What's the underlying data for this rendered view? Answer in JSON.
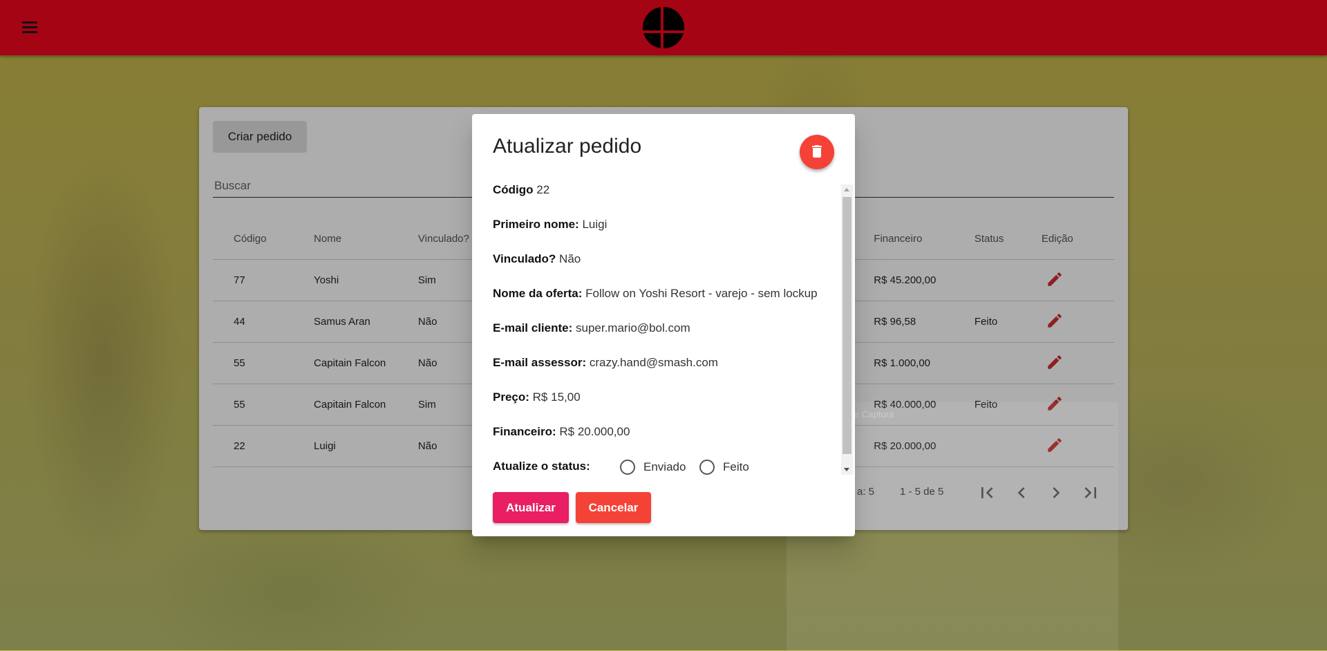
{
  "colors": {
    "topbar": "#a50415",
    "primary_button": "#e91e63",
    "warn_button": "#f44336",
    "edit_icon": "#d32f2f"
  },
  "header": {
    "menu_icon": "hamburger-menu-icon",
    "logo_icon": "smash-bros-logo"
  },
  "page": {
    "create_button_label": "Criar pedido",
    "search": {
      "placeholder": "Buscar",
      "value": ""
    },
    "table": {
      "columns": [
        "Código",
        "Nome",
        "Vinculado?",
        "Financeiro",
        "Status",
        "Edição"
      ],
      "rows": [
        {
          "codigo": "77",
          "nome": "Yoshi",
          "vinculado": "Sim",
          "financeiro": "R$ 45.200,00",
          "status": ""
        },
        {
          "codigo": "44",
          "nome": "Samus Aran",
          "vinculado": "Não",
          "financeiro": "R$ 96,58",
          "status": "Feito"
        },
        {
          "codigo": "55",
          "nome": "Capitain Falcon",
          "vinculado": "Não",
          "financeiro": "R$ 1.000,00",
          "status": ""
        },
        {
          "codigo": "55",
          "nome": "Capitain Falcon",
          "vinculado": "Sim",
          "financeiro": "R$ 40.000,00",
          "status": "Feito"
        },
        {
          "codigo": "22",
          "nome": "Luigi",
          "vinculado": "Não",
          "financeiro": "R$ 20.000,00",
          "status": ""
        }
      ]
    },
    "paginator": {
      "page_size_label": "a: 5",
      "range_label": "1 - 5 de 5"
    }
  },
  "dialog": {
    "title": "Atualizar pedido",
    "delete_icon": "trash-icon",
    "fields": [
      {
        "label": "Código",
        "value": "22"
      },
      {
        "label": "Primeiro nome:",
        "value": "Luigi"
      },
      {
        "label": "Vinculado?",
        "value": "Não"
      },
      {
        "label": "Nome da oferta:",
        "value": "Follow on Yoshi Resort - varejo - sem lockup"
      },
      {
        "label": "E-mail cliente:",
        "value": "super.mario@bol.com"
      },
      {
        "label": "E-mail assessor:",
        "value": "crazy.hand@smash.com"
      },
      {
        "label": "Preço:",
        "value": "R$ 15,00"
      },
      {
        "label": "Financeiro:",
        "value": "R$ 20.000,00"
      }
    ],
    "status_prompt": "Atualize o status:",
    "status_options": [
      "Enviado",
      "Feito"
    ],
    "submit_label": "Atualizar",
    "cancel_label": "Cancelar"
  },
  "background_overlay_text": "Ferramenta de Captura"
}
